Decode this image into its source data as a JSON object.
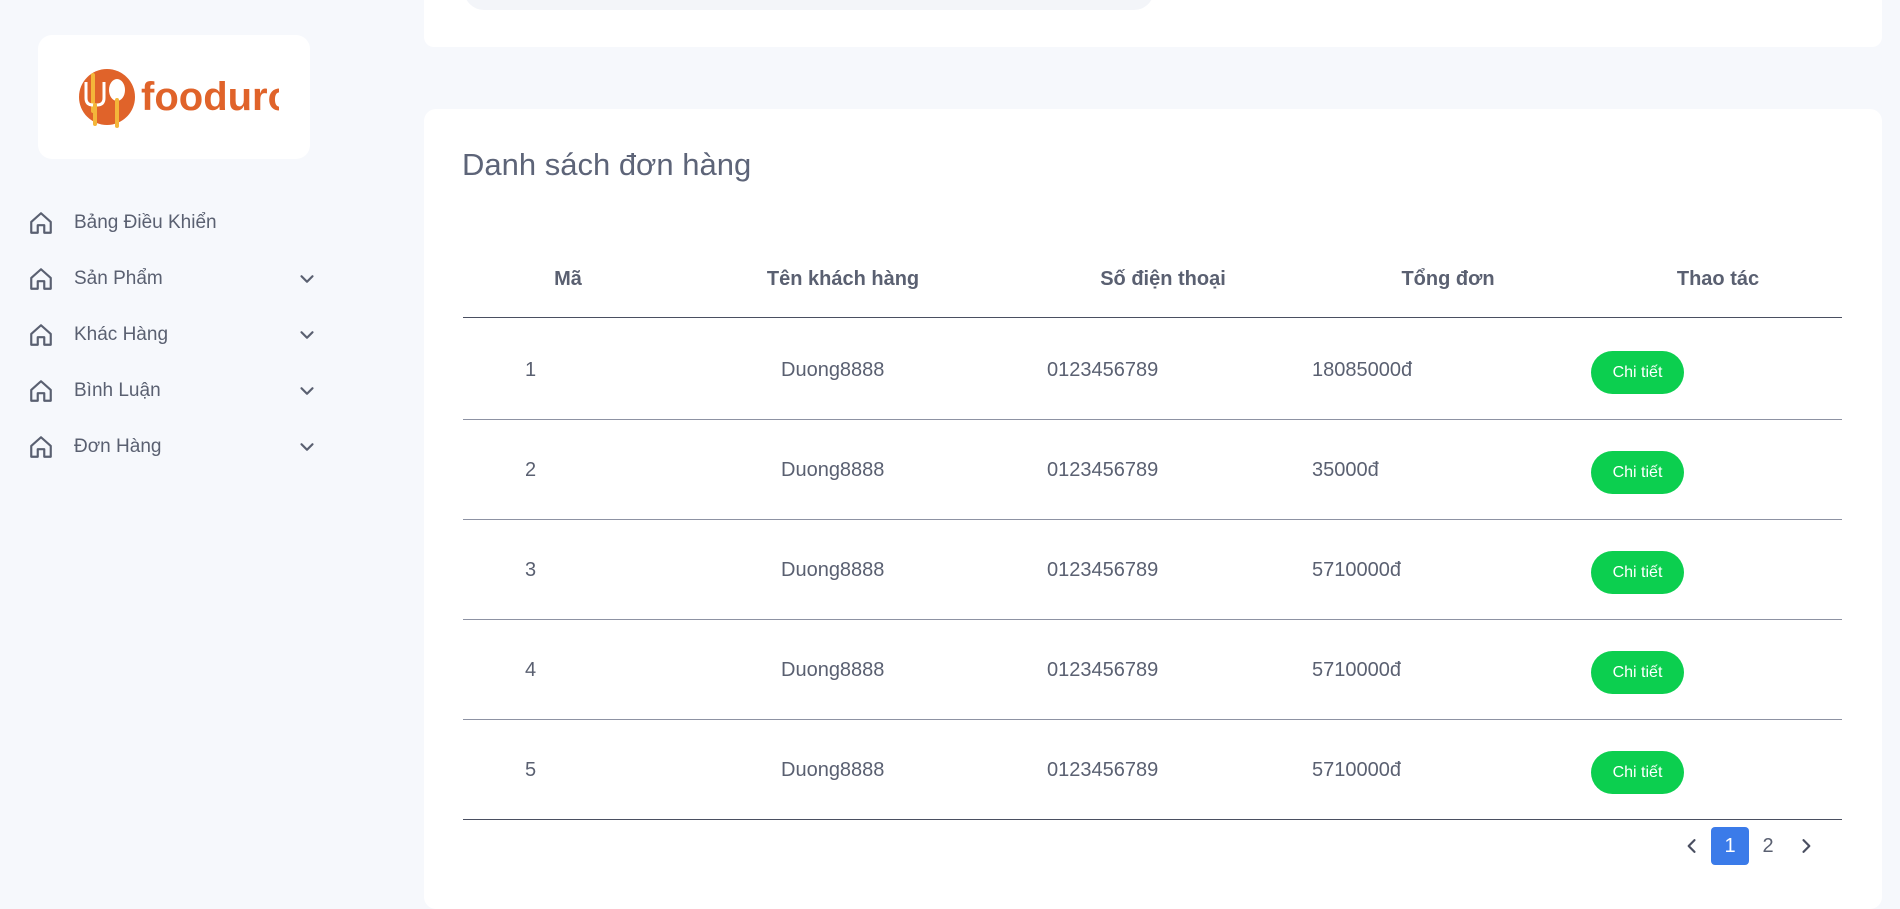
{
  "brand": {
    "name": "fooduro"
  },
  "colors": {
    "brand_orange": "#e0632a",
    "accent_green": "#0ccf4f",
    "active_blue": "#3b7be9"
  },
  "sidebar": {
    "items": [
      {
        "label": "Bảng Điều Khiển",
        "icon": "home-icon",
        "has_chevron": false
      },
      {
        "label": "Sản Phẩm",
        "icon": "home-icon",
        "has_chevron": true
      },
      {
        "label": "Khác Hàng",
        "icon": "home-icon",
        "has_chevron": true
      },
      {
        "label": "Bình Luận",
        "icon": "home-icon",
        "has_chevron": true
      },
      {
        "label": "Đơn Hàng",
        "icon": "home-icon",
        "has_chevron": true
      }
    ]
  },
  "orders": {
    "title": "Danh sách đơn hàng",
    "columns": [
      "Mã",
      "Tên khách hàng",
      "Số điện thoại",
      "Tổng đơn",
      "Thao tác"
    ],
    "rows": [
      {
        "id": "1",
        "customer": "Duong8888",
        "phone": "0123456789",
        "total": "18085000đ",
        "action": "Chi tiết"
      },
      {
        "id": "2",
        "customer": "Duong8888",
        "phone": "0123456789",
        "total": "35000đ",
        "action": "Chi tiết"
      },
      {
        "id": "3",
        "customer": "Duong8888",
        "phone": "0123456789",
        "total": "5710000đ",
        "action": "Chi tiết"
      },
      {
        "id": "4",
        "customer": "Duong8888",
        "phone": "0123456789",
        "total": "5710000đ",
        "action": "Chi tiết"
      },
      {
        "id": "5",
        "customer": "Duong8888",
        "phone": "0123456789",
        "total": "5710000đ",
        "action": "Chi tiết"
      }
    ]
  },
  "pagination": {
    "pages": [
      "1",
      "2"
    ],
    "current": "1"
  }
}
